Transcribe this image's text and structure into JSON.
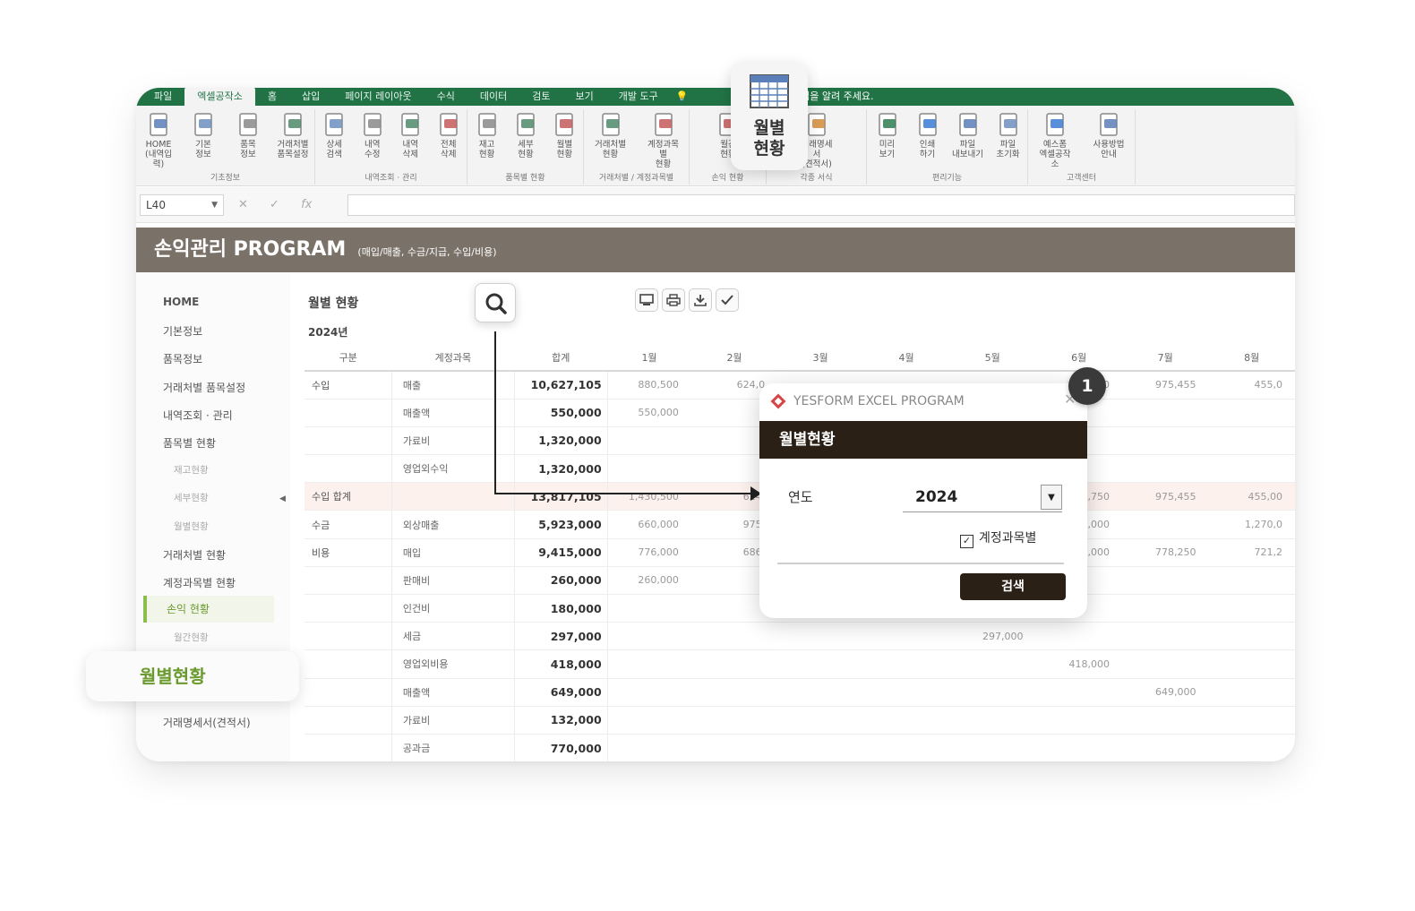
{
  "ribbon": {
    "tabs": [
      "파일",
      "엑셀공작소",
      "홈",
      "삽입",
      "페이지 레이아웃",
      "수식",
      "데이터",
      "검토",
      "보기",
      "개발 도구",
      "💡",
      "할 작업을 알려 주세요."
    ],
    "active_tab_index": 1,
    "groups": [
      {
        "name": "기초정보",
        "buttons": [
          "HOME\n(내역입력)",
          "기본\n정보",
          "품목\n정보",
          "거래처별\n품목설정"
        ]
      },
      {
        "name": "내역조회 · 관리",
        "buttons": [
          "상세\n검색",
          "내역\n수정",
          "내역\n삭제",
          "전체\n삭제"
        ]
      },
      {
        "name": "품목별 현황",
        "buttons": [
          "재고\n현황",
          "세부\n현황",
          "월별\n현황"
        ]
      },
      {
        "name": "거래처별 / 계정과목별",
        "buttons": [
          "거래처별\n현황",
          "계정과목별\n현황"
        ]
      },
      {
        "name": "손익 현황",
        "buttons": [
          "월간\n현황"
        ]
      },
      {
        "name": "각종 서식",
        "buttons": [
          "거래명세서\n(견적서)"
        ]
      },
      {
        "name": "편리기능",
        "buttons": [
          "미리\n보기",
          "인쇄\n하기",
          "파일\n내보내기",
          "파일\n초기화"
        ]
      },
      {
        "name": "고객센터",
        "buttons": [
          "예스폼\n엑셀공작소",
          "사용방법\n안내"
        ]
      }
    ]
  },
  "formula_bar": {
    "cell_ref": "L40",
    "cancel": "✕",
    "enter": "✓",
    "fx": "fx"
  },
  "program": {
    "title": "손익관리 PROGRAM",
    "subtitle": "(매입/매출, 수금/지급, 수입/비용)"
  },
  "sidebar": {
    "items": [
      {
        "label": "HOME",
        "type": "home"
      },
      {
        "label": "기본정보",
        "type": "item"
      },
      {
        "label": "품목정보",
        "type": "item"
      },
      {
        "label": "거래처별 품목설정",
        "type": "item"
      },
      {
        "label": "내역조회 · 관리",
        "type": "item"
      },
      {
        "label": "품목별 현황",
        "type": "item"
      },
      {
        "label": "재고현황",
        "type": "sub"
      },
      {
        "label": "세부현황",
        "type": "sub"
      },
      {
        "label": "월별현황",
        "type": "sub"
      },
      {
        "label": "거래처별 현황",
        "type": "item"
      },
      {
        "label": "계정과목별 현황",
        "type": "item"
      },
      {
        "label": "손익 현황",
        "type": "active"
      },
      {
        "label": "월간현황",
        "type": "sub"
      },
      {
        "label": "",
        "type": "hidden"
      },
      {
        "label": "",
        "type": "hidden"
      },
      {
        "label": "거래명세서(견적서)",
        "type": "item"
      }
    ],
    "arrow": "◀"
  },
  "main": {
    "title": "월별 현황",
    "year_label": "2024년",
    "tool_icons": [
      "monitor-icon",
      "print-icon",
      "download-icon",
      "check-icon"
    ],
    "columns": [
      "구분",
      "계정과목",
      "합계",
      "1월",
      "2월",
      "3월",
      "4월",
      "5월",
      "6월",
      "7월",
      "8월"
    ],
    "rows": [
      {
        "group": "수입",
        "account": "매출",
        "total": "10,627,105",
        "months": [
          "880,500",
          "624,0",
          "",
          "",
          "",
          "94,750",
          "975,455",
          "455,0"
        ],
        "sum": false
      },
      {
        "group": "",
        "account": "매출액",
        "total": "550,000",
        "months": [
          "550,000",
          "",
          "",
          "",
          "",
          "",
          "",
          ""
        ],
        "sum": false
      },
      {
        "group": "",
        "account": "가료비",
        "total": "1,320,000",
        "months": [
          "",
          "",
          "",
          "",
          "",
          "",
          "",
          ""
        ],
        "sum": false
      },
      {
        "group": "",
        "account": "영업외수익",
        "total": "1,320,000",
        "months": [
          "",
          "",
          "",
          "",
          "",
          "",
          "",
          ""
        ],
        "sum": false
      },
      {
        "group": "수입 합계",
        "account": "",
        "total": "13,817,105",
        "months": [
          "1,430,500",
          "624,",
          "",
          "",
          "",
          "94,750",
          "975,455",
          "455,00"
        ],
        "sum": true
      },
      {
        "group": "수금",
        "account": "외상매출",
        "total": "5,923,000",
        "months": [
          "660,000",
          "975,",
          "",
          "",
          "",
          "700,000",
          "",
          "1,270,0"
        ],
        "sum": false
      },
      {
        "group": "비용",
        "account": "매입",
        "total": "9,415,000",
        "months": [
          "776,000",
          "686,",
          "",
          "",
          "",
          "315,000",
          "778,250",
          "721,2"
        ],
        "sum": false
      },
      {
        "group": "",
        "account": "판매비",
        "total": "260,000",
        "months": [
          "260,000",
          "",
          "",
          "",
          "",
          "",
          "",
          ""
        ],
        "sum": false
      },
      {
        "group": "",
        "account": "인건비",
        "total": "180,000",
        "months": [
          "",
          "",
          "",
          "",
          "",
          "",
          "",
          ""
        ],
        "sum": false
      },
      {
        "group": "",
        "account": "세금",
        "total": "297,000",
        "months": [
          "",
          "",
          "",
          "",
          "297,000",
          "",
          "",
          ""
        ],
        "sum": false
      },
      {
        "group": "",
        "account": "영업외비용",
        "total": "418,000",
        "months": [
          "",
          "",
          "",
          "",
          "",
          "418,000",
          "",
          ""
        ],
        "sum": false
      },
      {
        "group": "",
        "account": "매출액",
        "total": "649,000",
        "months": [
          "",
          "",
          "",
          "",
          "",
          "",
          "649,000",
          ""
        ],
        "sum": false
      },
      {
        "group": "",
        "account": "가료비",
        "total": "132,000",
        "months": [
          "",
          "",
          "",
          "",
          "",
          "",
          "",
          ""
        ],
        "sum": false
      },
      {
        "group": "",
        "account": "공과금",
        "total": "770,000",
        "months": [
          "",
          "",
          "",
          "",
          "",
          "",
          "",
          ""
        ],
        "sum": false
      }
    ]
  },
  "popup": {
    "app_title": "YESFORM EXCEL PROGRAM",
    "close": "✕",
    "header": "월별현황",
    "year_label": "연도",
    "year_value": "2024",
    "dropdown": "▼",
    "checkbox_mark": "☑",
    "checkbox_label": "계정과목별",
    "search_button": "검색"
  },
  "callouts": {
    "step_badge": "1",
    "ribbon_zoom_label": "월별\n현황",
    "sidebar_zoom_label": "월별현황"
  },
  "colors": {
    "excel_green": "#217346",
    "header_brown": "#7a7168",
    "popup_dark": "#2a2016",
    "accent_green": "#6b9a2f"
  }
}
